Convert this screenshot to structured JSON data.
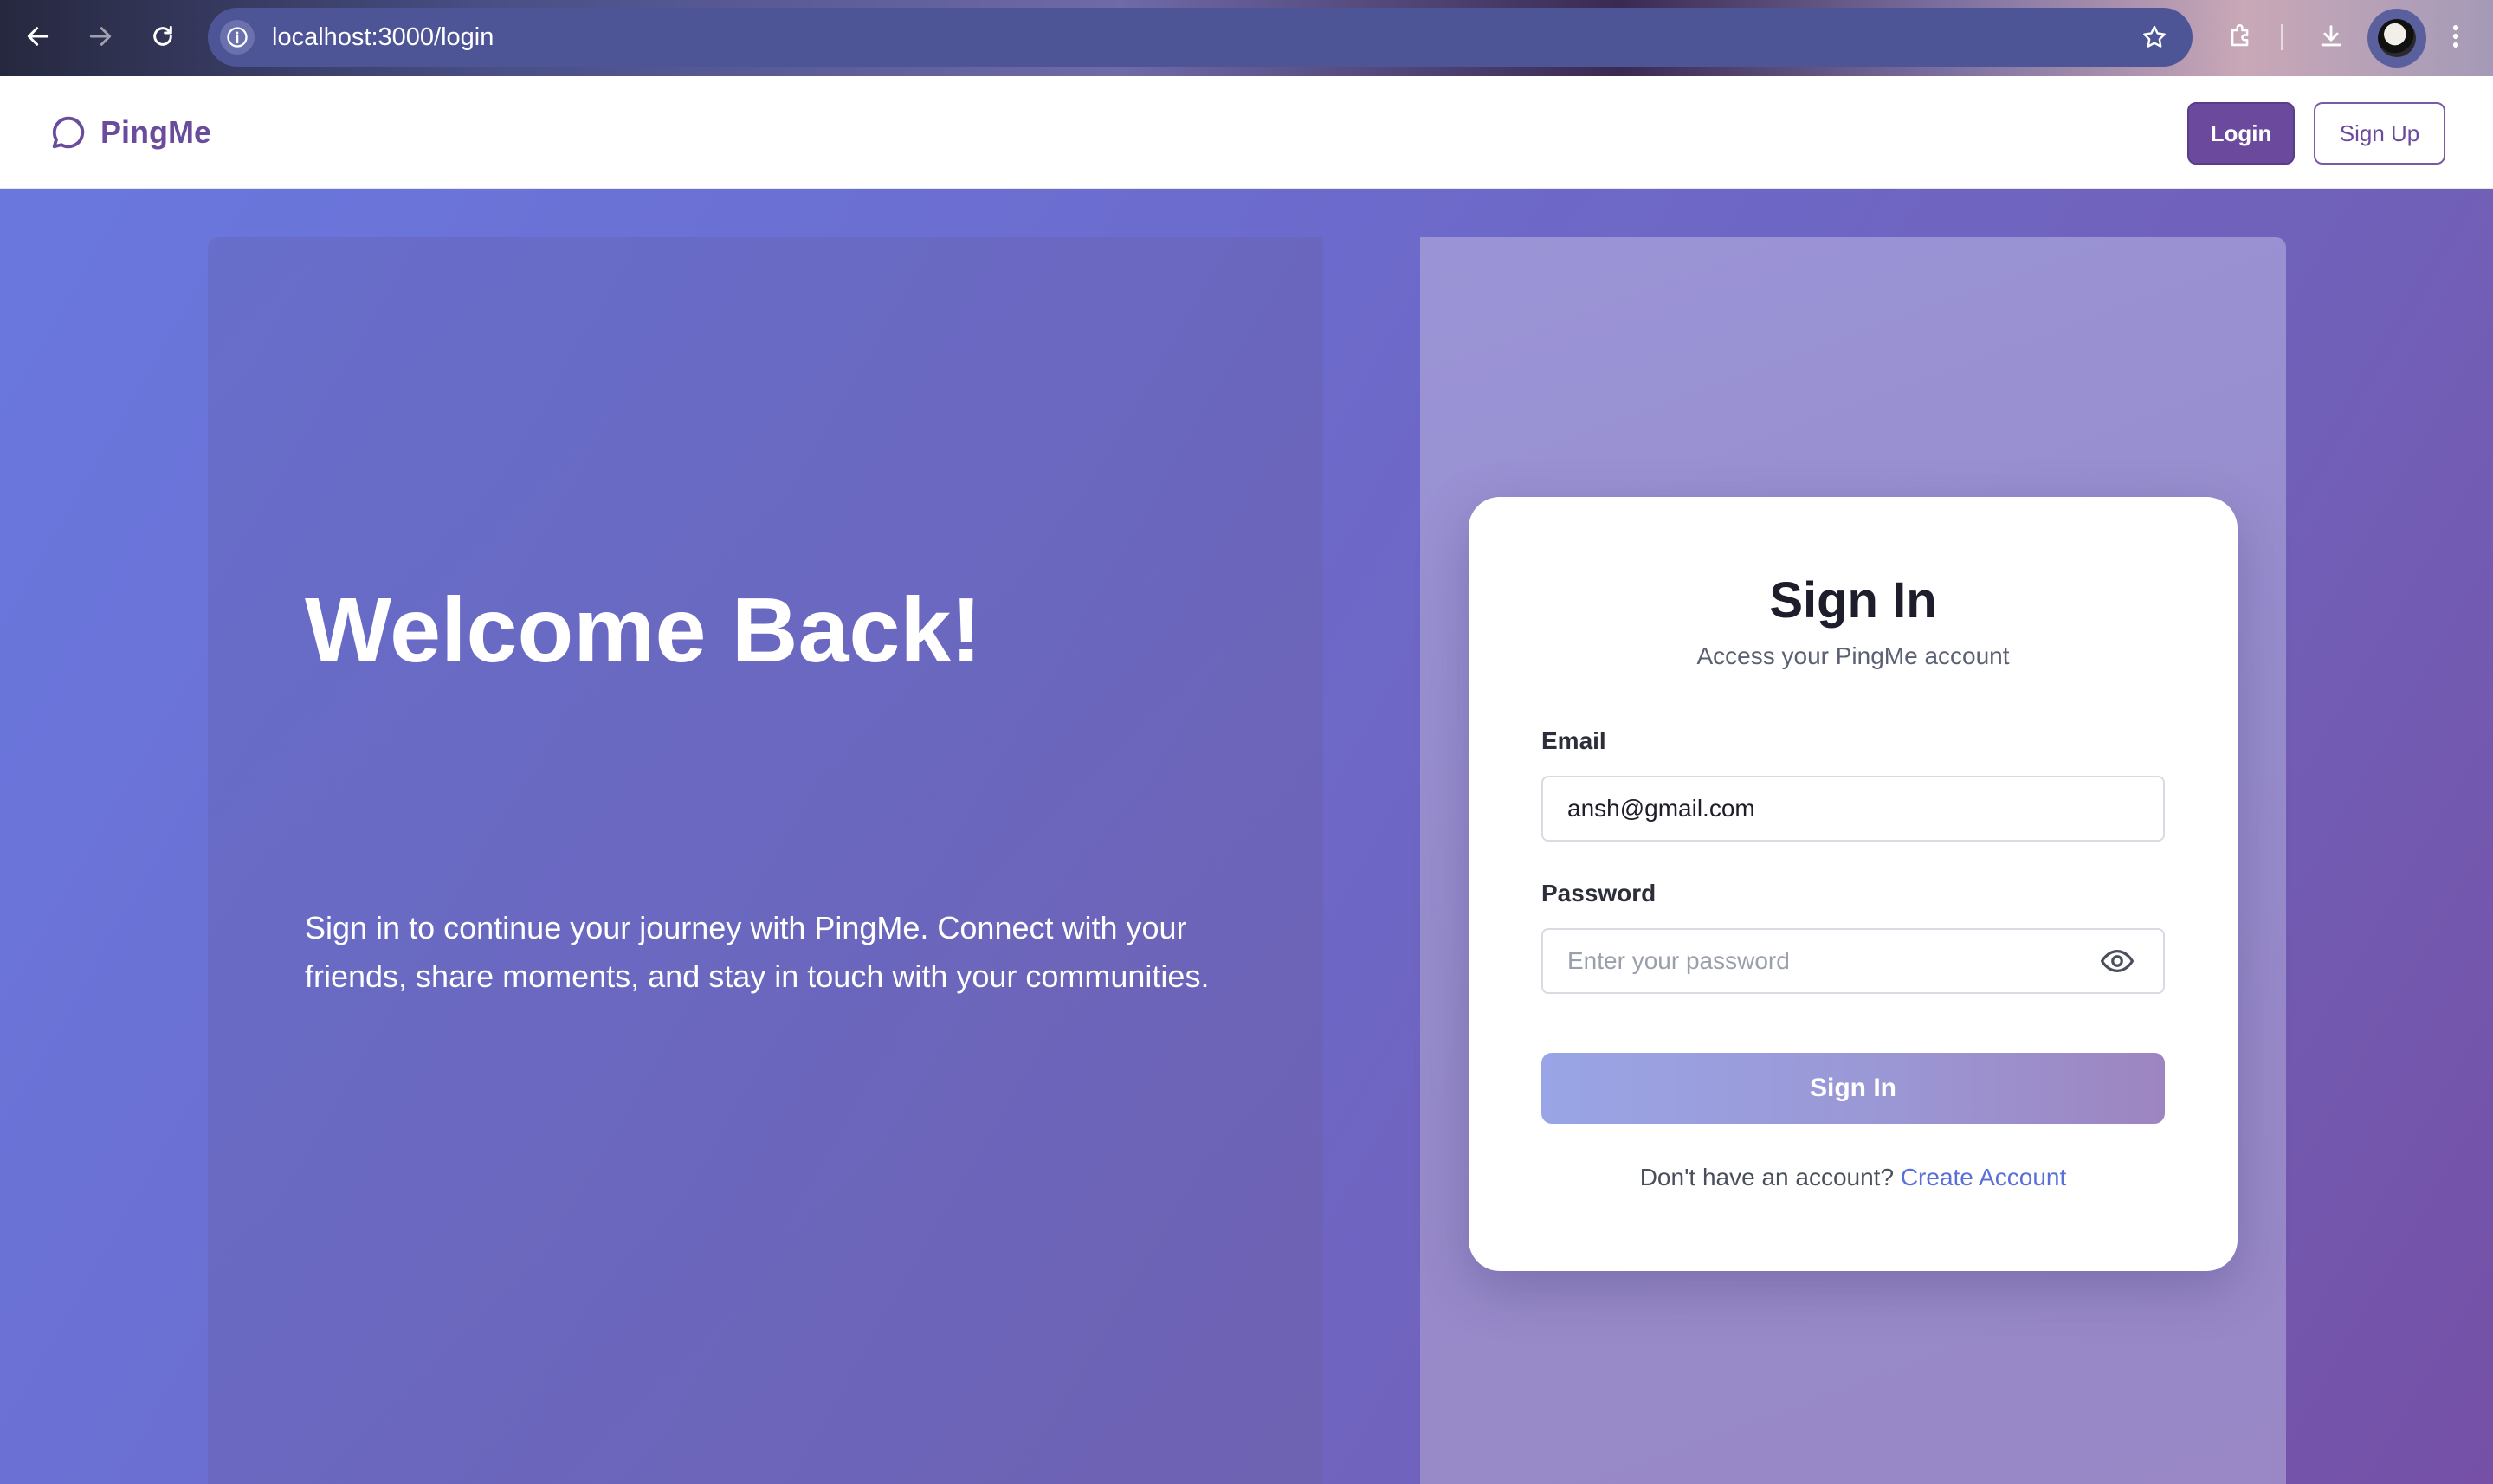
{
  "browser": {
    "url": "localhost:3000/login"
  },
  "header": {
    "brand": "PingMe",
    "login_label": "Login",
    "signup_label": "Sign Up"
  },
  "hero": {
    "title": "Welcome Back!",
    "description": "Sign in to continue your journey with PingMe. Connect with your friends, share moments, and stay in touch with your communities."
  },
  "signin_card": {
    "title": "Sign In",
    "subtitle": "Access your PingMe account",
    "email_label": "Email",
    "email_value": "ansh@gmail.com",
    "password_label": "Password",
    "password_placeholder": "Enter your password",
    "submit_label": "Sign In",
    "footer_text": "Don't have an account?",
    "create_account_label": "Create Account"
  },
  "icons": {
    "back": "arrow-left-icon",
    "forward": "arrow-right-icon",
    "reload": "reload-icon",
    "site_info": "info-icon",
    "bookmark": "star-icon",
    "extensions": "puzzle-icon",
    "downloads": "download-icon",
    "menu": "kebab-menu-icon",
    "brand": "chat-bubble-icon",
    "password_toggle": "eye-icon"
  },
  "colors": {
    "brand": "#6b4a9e",
    "link": "#5a6fd8",
    "background_start": "#6a78de",
    "background_end": "#7550a6"
  }
}
